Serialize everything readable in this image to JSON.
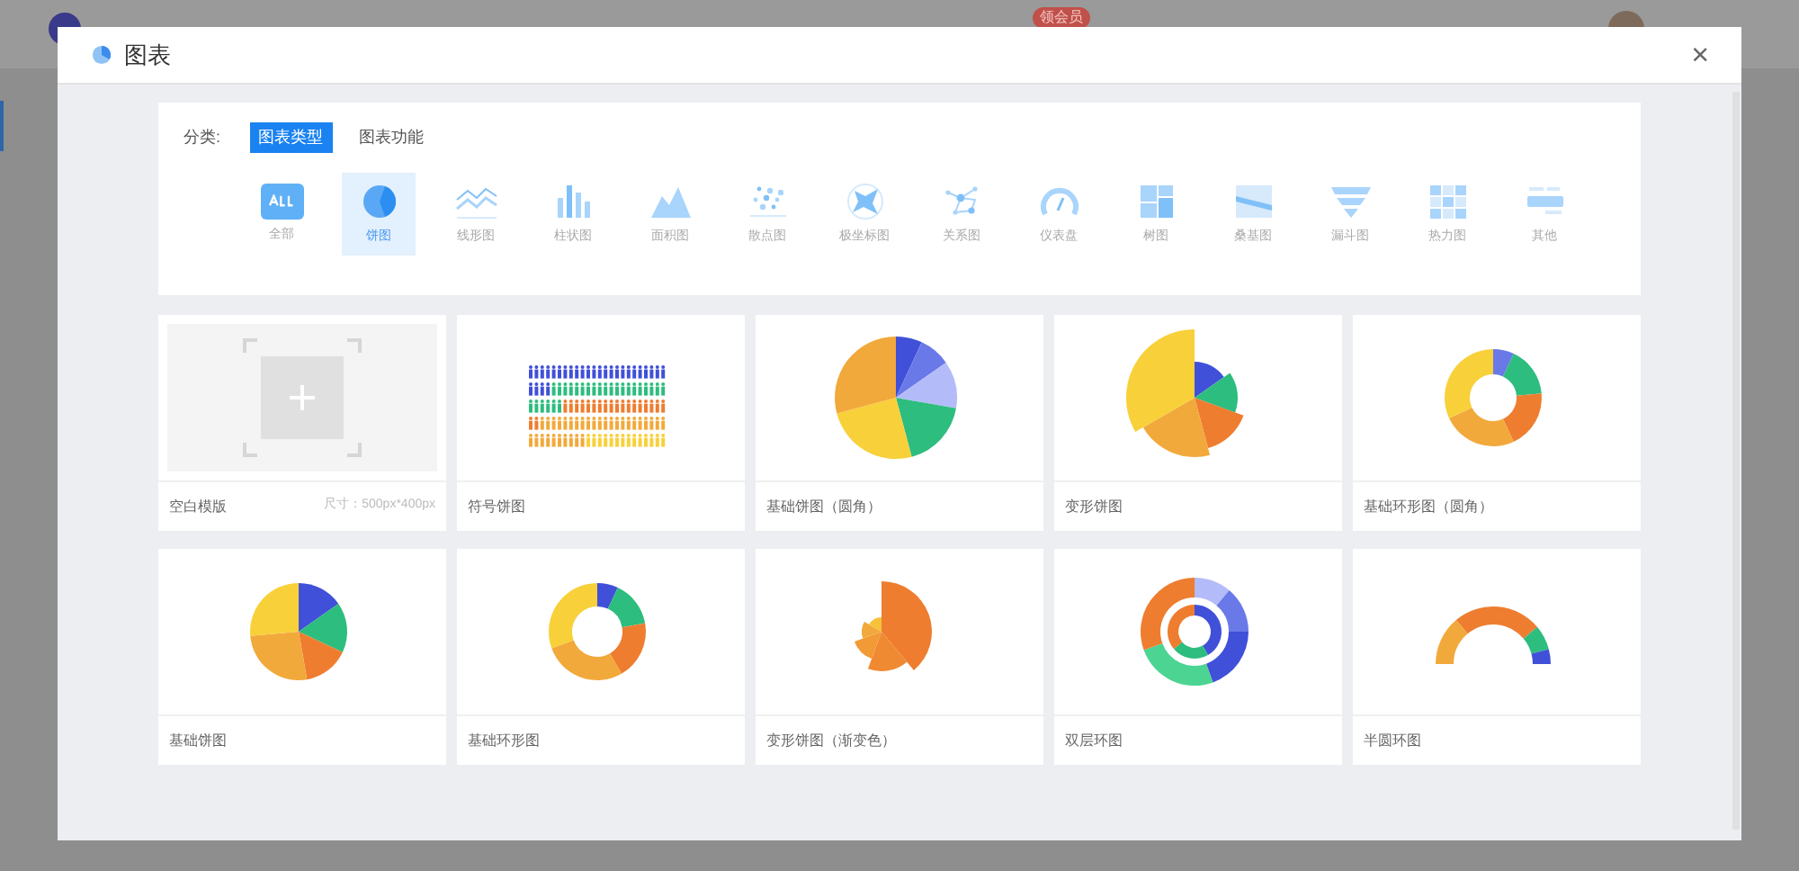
{
  "app_bar": {
    "badge": "领会员"
  },
  "dialog": {
    "title": "图表",
    "close": "×"
  },
  "filter": {
    "label": "分类:",
    "tabs": [
      {
        "label": "图表类型",
        "selected": true
      },
      {
        "label": "图表功能",
        "selected": false
      }
    ],
    "categories": [
      {
        "kind": "all",
        "label": "全部",
        "selected": false
      },
      {
        "kind": "pie",
        "label": "饼图",
        "selected": true
      },
      {
        "kind": "line",
        "label": "线形图",
        "selected": false
      },
      {
        "kind": "bar",
        "label": "柱状图",
        "selected": false
      },
      {
        "kind": "area",
        "label": "面积图",
        "selected": false
      },
      {
        "kind": "scatter",
        "label": "散点图",
        "selected": false
      },
      {
        "kind": "polar",
        "label": "极坐标图",
        "selected": false
      },
      {
        "kind": "graph",
        "label": "关系图",
        "selected": false
      },
      {
        "kind": "gauge",
        "label": "仪表盘",
        "selected": false
      },
      {
        "kind": "tree",
        "label": "树图",
        "selected": false
      },
      {
        "kind": "sankey",
        "label": "桑基图",
        "selected": false
      },
      {
        "kind": "funnel",
        "label": "漏斗图",
        "selected": false
      },
      {
        "kind": "heatmap",
        "label": "热力图",
        "selected": false
      },
      {
        "kind": "other",
        "label": "其他",
        "selected": false
      }
    ]
  },
  "templates": [
    {
      "kind": "blank",
      "name": "空白模版",
      "size": "尺寸：500px*400px"
    },
    {
      "kind": "pictorial",
      "name": "符号饼图"
    },
    {
      "kind": "pie_round",
      "name": "基础饼图（圆角）"
    },
    {
      "kind": "rose",
      "name": "变形饼图"
    },
    {
      "kind": "donut_round",
      "name": "基础环形图（圆角）"
    },
    {
      "kind": "pie",
      "name": "基础饼图"
    },
    {
      "kind": "donut",
      "name": "基础环形图"
    },
    {
      "kind": "rose_gradient",
      "name": "变形饼图（渐变色）"
    },
    {
      "kind": "double_ring",
      "name": "双层环图"
    },
    {
      "kind": "half_ring",
      "name": "半圆环图"
    }
  ]
}
